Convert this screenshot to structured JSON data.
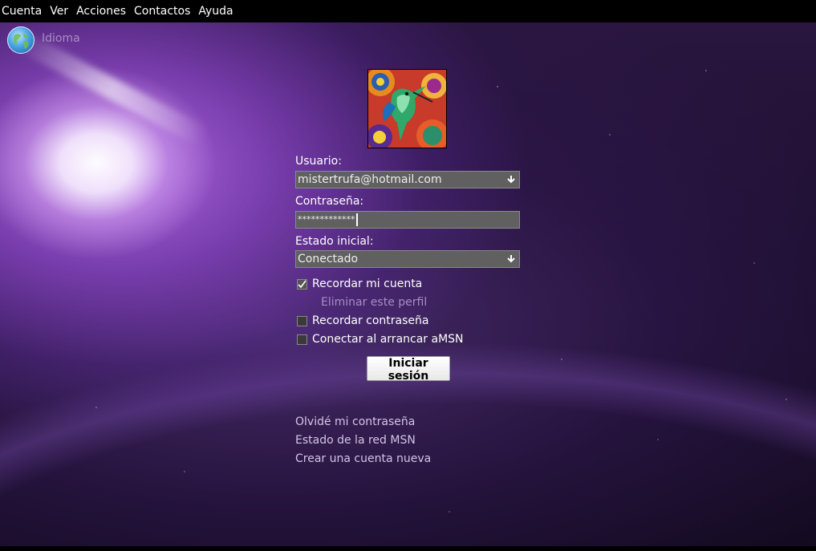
{
  "menubar": {
    "items": [
      "Cuenta",
      "Ver",
      "Acciones",
      "Contactos",
      "Ayuda"
    ]
  },
  "language": {
    "label": "Idioma",
    "icon": "globe-icon"
  },
  "login": {
    "user_label": "Usuario:",
    "user_value": "mistertrufa@hotmail.com",
    "password_label": "Contraseña:",
    "password_value": "*************",
    "status_label": "Estado inicial:",
    "status_value": "Conectado",
    "remember_account": {
      "label": "Recordar mi cuenta",
      "checked": true
    },
    "delete_profile": "Eliminar este perfil",
    "remember_password": {
      "label": "Recordar contraseña",
      "checked": false
    },
    "autoconnect": {
      "label": "Conectar al arrancar aMSN",
      "checked": false
    },
    "login_button": "Iniciar sesión"
  },
  "links": {
    "forgot_password": "Olvidé mi contraseña",
    "network_status": "Estado de la red MSN",
    "create_account": "Crear una cuenta nueva"
  },
  "colors": {
    "accent_link": "#a98cc4",
    "field_bg": "#606060"
  }
}
